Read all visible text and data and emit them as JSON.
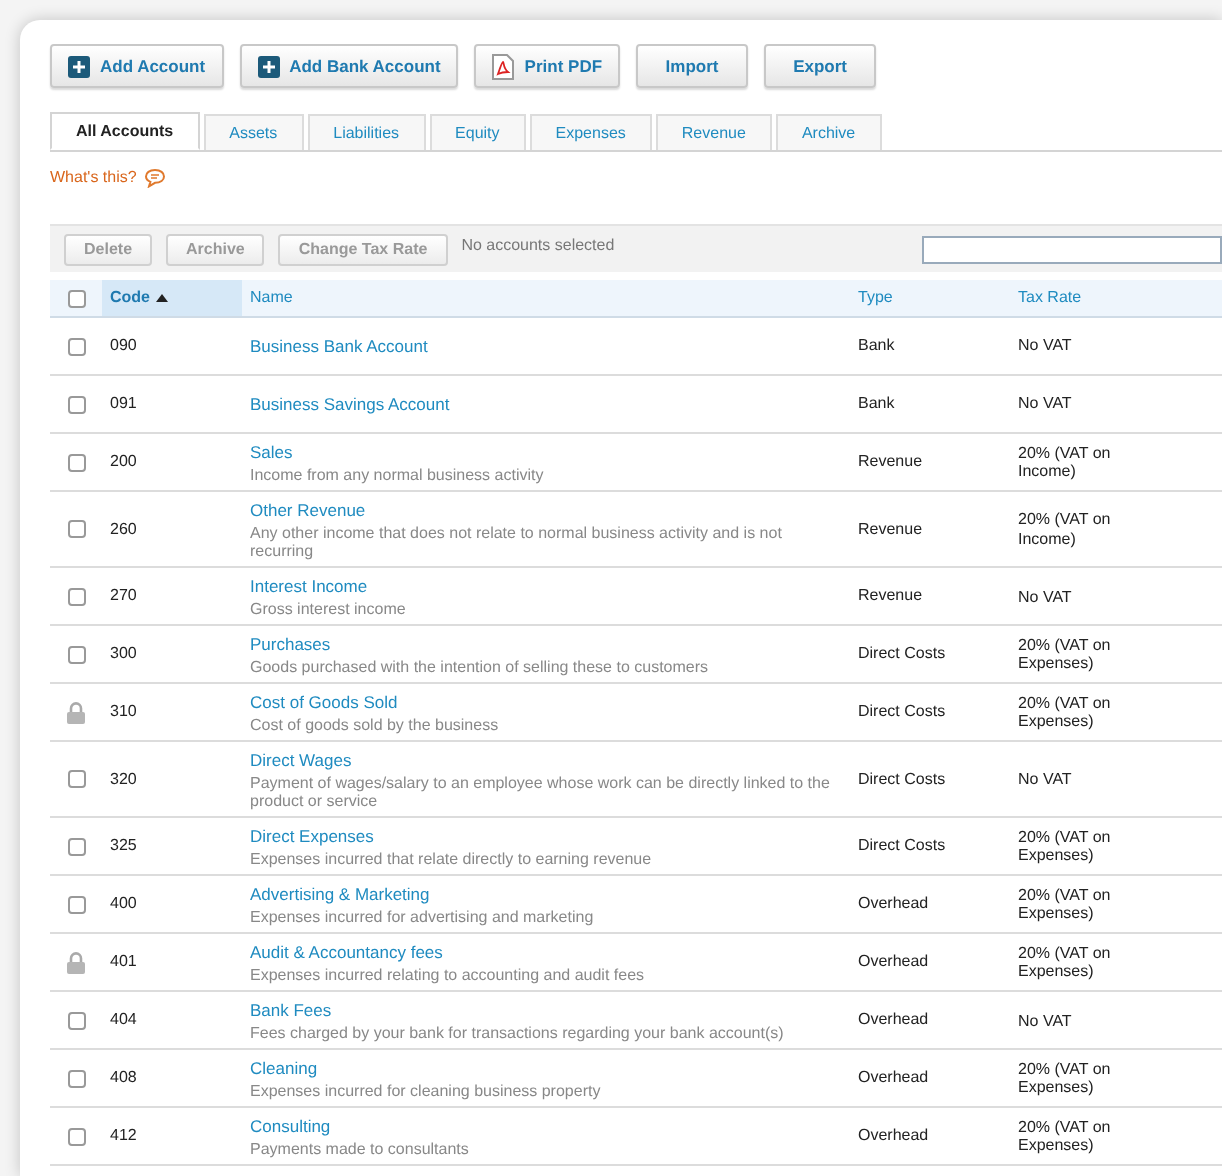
{
  "toolbar": [
    {
      "label": "Add Account",
      "kind": "add"
    },
    {
      "label": "Add Bank Account",
      "kind": "add"
    },
    {
      "label": "Print PDF",
      "kind": "print"
    },
    {
      "label": "Import",
      "kind": "plain"
    },
    {
      "label": "Export",
      "kind": "plain"
    }
  ],
  "tabs": [
    {
      "label": "All Accounts",
      "selected": true
    },
    {
      "label": "Assets",
      "selected": false
    },
    {
      "label": "Liabilities",
      "selected": false
    },
    {
      "label": "Equity",
      "selected": false
    },
    {
      "label": "Expenses",
      "selected": false
    },
    {
      "label": "Revenue",
      "selected": false
    },
    {
      "label": "Archive",
      "selected": false
    }
  ],
  "help_link": "What's this?",
  "bulk_actions": {
    "buttons": [
      {
        "label": "Delete",
        "disabled": true
      },
      {
        "label": "Archive",
        "disabled": true
      },
      {
        "label": "Change Tax Rate",
        "disabled": true
      }
    ],
    "status": "No accounts selected"
  },
  "table": {
    "select_all": {
      "checked": false
    },
    "columns": [
      {
        "label": "Code",
        "sorted": true
      },
      {
        "label": "Name",
        "sorted": false
      },
      {
        "label": "Type",
        "sorted": false
      },
      {
        "label": "Tax Rate",
        "sorted": false
      }
    ],
    "rows": [
      {
        "kind": "checkbox",
        "checked": false,
        "code": "090",
        "name": "Business Bank Account",
        "type": "Bank",
        "tax_rate": "No VAT"
      },
      {
        "kind": "checkbox",
        "checked": false,
        "code": "091",
        "name": "Business Savings Account",
        "type": "Bank",
        "tax_rate": "No VAT"
      },
      {
        "kind": "checkbox",
        "checked": false,
        "code": "200",
        "name": "Sales",
        "description": "Income from any normal business activity",
        "type": "Revenue",
        "tax_rate": "20% (VAT on Income)"
      },
      {
        "kind": "checkbox",
        "checked": false,
        "code": "260",
        "name": "Other Revenue",
        "description": "Any other income that does not relate to normal business activity and is not recurring",
        "type": "Revenue",
        "tax_rate": "20% (VAT on Income)"
      },
      {
        "kind": "checkbox",
        "checked": false,
        "code": "270",
        "name": "Interest Income",
        "description": "Gross interest income",
        "type": "Revenue",
        "tax_rate": "No VAT"
      },
      {
        "kind": "checkbox",
        "checked": false,
        "code": "300",
        "name": "Purchases",
        "description": "Goods purchased with the intention of selling these to customers",
        "type": "Direct Costs",
        "tax_rate": "20% (VAT on Expenses)"
      },
      {
        "kind": "locked",
        "code": "310",
        "name": "Cost of Goods Sold",
        "description": "Cost of goods sold by the business",
        "type": "Direct Costs",
        "tax_rate": "20% (VAT on Expenses)"
      },
      {
        "kind": "checkbox",
        "checked": false,
        "code": "320",
        "name": "Direct Wages",
        "description": "Payment of wages/salary to an employee whose work can be directly linked to the product or service",
        "type": "Direct Costs",
        "tax_rate": "No VAT"
      },
      {
        "kind": "checkbox",
        "checked": false,
        "code": "325",
        "name": "Direct Expenses",
        "description": "Expenses incurred that relate directly to earning revenue",
        "type": "Direct Costs",
        "tax_rate": "20% (VAT on Expenses)"
      },
      {
        "kind": "checkbox",
        "checked": false,
        "code": "400",
        "name": "Advertising & Marketing",
        "description": "Expenses incurred for advertising and marketing",
        "type": "Overhead",
        "tax_rate": "20% (VAT on Expenses)"
      },
      {
        "kind": "locked",
        "code": "401",
        "name": "Audit & Accountancy fees",
        "description": "Expenses incurred relating to accounting and audit fees",
        "type": "Overhead",
        "tax_rate": "20% (VAT on Expenses)"
      },
      {
        "kind": "checkbox",
        "checked": false,
        "code": "404",
        "name": "Bank Fees",
        "description": "Fees charged by your bank for transactions regarding your bank account(s)",
        "type": "Overhead",
        "tax_rate": "No VAT"
      },
      {
        "kind": "checkbox",
        "checked": false,
        "code": "408",
        "name": "Cleaning",
        "description": "Expenses incurred for cleaning business property",
        "type": "Overhead",
        "tax_rate": "20% (VAT on Expenses)"
      },
      {
        "kind": "checkbox",
        "checked": false,
        "code": "412",
        "name": "Consulting",
        "description": "Payments made to consultants",
        "type": "Overhead",
        "tax_rate": "20% (VAT on Expenses)"
      }
    ]
  }
}
